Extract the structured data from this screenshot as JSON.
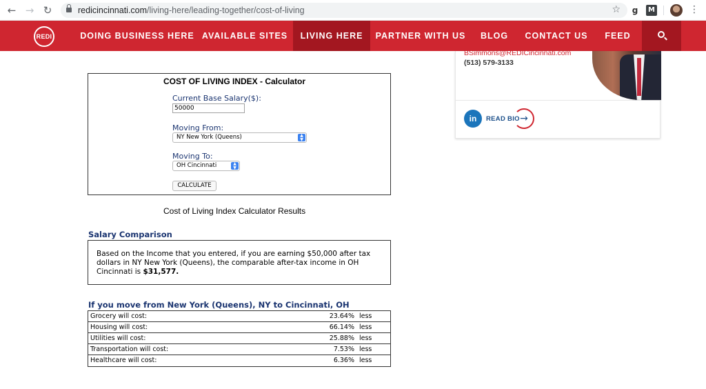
{
  "browser": {
    "url_domain": "redicincinnati.com",
    "url_path": "/living-here/leading-together/cost-of-living",
    "ext_g": "g",
    "ext_m": "M"
  },
  "site_nav": {
    "logo_text": "REDI",
    "items": [
      "DOING BUSINESS HERE",
      "AVAILABLE SITES",
      "LIVING HERE",
      "PARTNER WITH US",
      "BLOG",
      "CONTACT US",
      "FEED"
    ],
    "active_index": 2,
    "accent_color": "#cf2630",
    "active_color": "#a31720"
  },
  "contact_card": {
    "email": "BSimmons@REDICincinnati.com",
    "phone": "(513) 579-3133",
    "linkedin_label": "in",
    "read_bio_label": "READ BIO"
  },
  "calculator": {
    "title": "COST OF LIVING INDEX - Calculator",
    "salary_label": "Current Base Salary($):",
    "salary_value": "50000",
    "from_label": "Moving From:",
    "from_value": "NY New York (Queens)",
    "to_label": "Moving To:",
    "to_value": "OH Cincinnati",
    "calculate_label": "CALCULATE"
  },
  "results": {
    "title": "Cost of Living Index Calculator Results",
    "salary_heading": "Salary Comparison",
    "salary_text_pre": "Based on the Income that you entered, if you are earning $50,000 after tax dollars in NY New York (Queens), the comparable after-tax income in OH Cincinnati is ",
    "salary_amount": "$31,577.",
    "move_heading": "If you move from New York (Queens), NY to Cincinnati, OH",
    "rows": [
      {
        "label": "Grocery will cost:",
        "percent": "23.64%",
        "direction": "less"
      },
      {
        "label": "Housing will cost:",
        "percent": "66.14%",
        "direction": "less"
      },
      {
        "label": "Utilities will cost:",
        "percent": "25.88%",
        "direction": "less"
      },
      {
        "label": "Transportation will cost:",
        "percent": "7.53%",
        "direction": "less"
      },
      {
        "label": "Healthcare will cost:",
        "percent": "6.36%",
        "direction": "less"
      }
    ]
  }
}
